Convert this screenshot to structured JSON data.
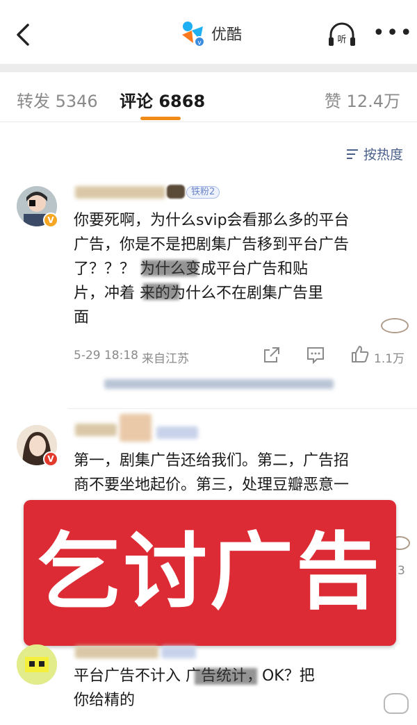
{
  "header": {
    "app_name": "优酷",
    "listen_label": "听",
    "more_label": "•••"
  },
  "tabs": {
    "forward": "转发 5346",
    "comments": "评论 6868",
    "likes": "赞 12.4万"
  },
  "sort": {
    "label": "按热度"
  },
  "comments": [
    {
      "fan_badge": "铁粉2",
      "text_lines": [
        "你要死啊，为什么svip会看那么多的平台",
        "广告，你是不是把剧集广告移到平台广告",
        "了？？？             为什么变成平台广告和贴",
        "片，冲着       来的为什么不在剧集广告里",
        "面"
      ],
      "time": "5-29 18:18",
      "location": "来自江苏",
      "like_count": "1.1万"
    },
    {
      "text_lines": [
        "第一，剧集广告还给我们。第二，广告招",
        "商不要坐地起价。第三，处理豆瓣恶意一"
      ],
      "partial_count": "3"
    },
    {
      "text_lines": [
        "平台广告不计入            广告统计，OK？把",
        "你给精的"
      ]
    }
  ],
  "overlay": {
    "text": "乞讨广告"
  },
  "colors": {
    "accent": "#f08a1a",
    "overlay": "#dc2b34",
    "link": "#4a5f8a"
  }
}
